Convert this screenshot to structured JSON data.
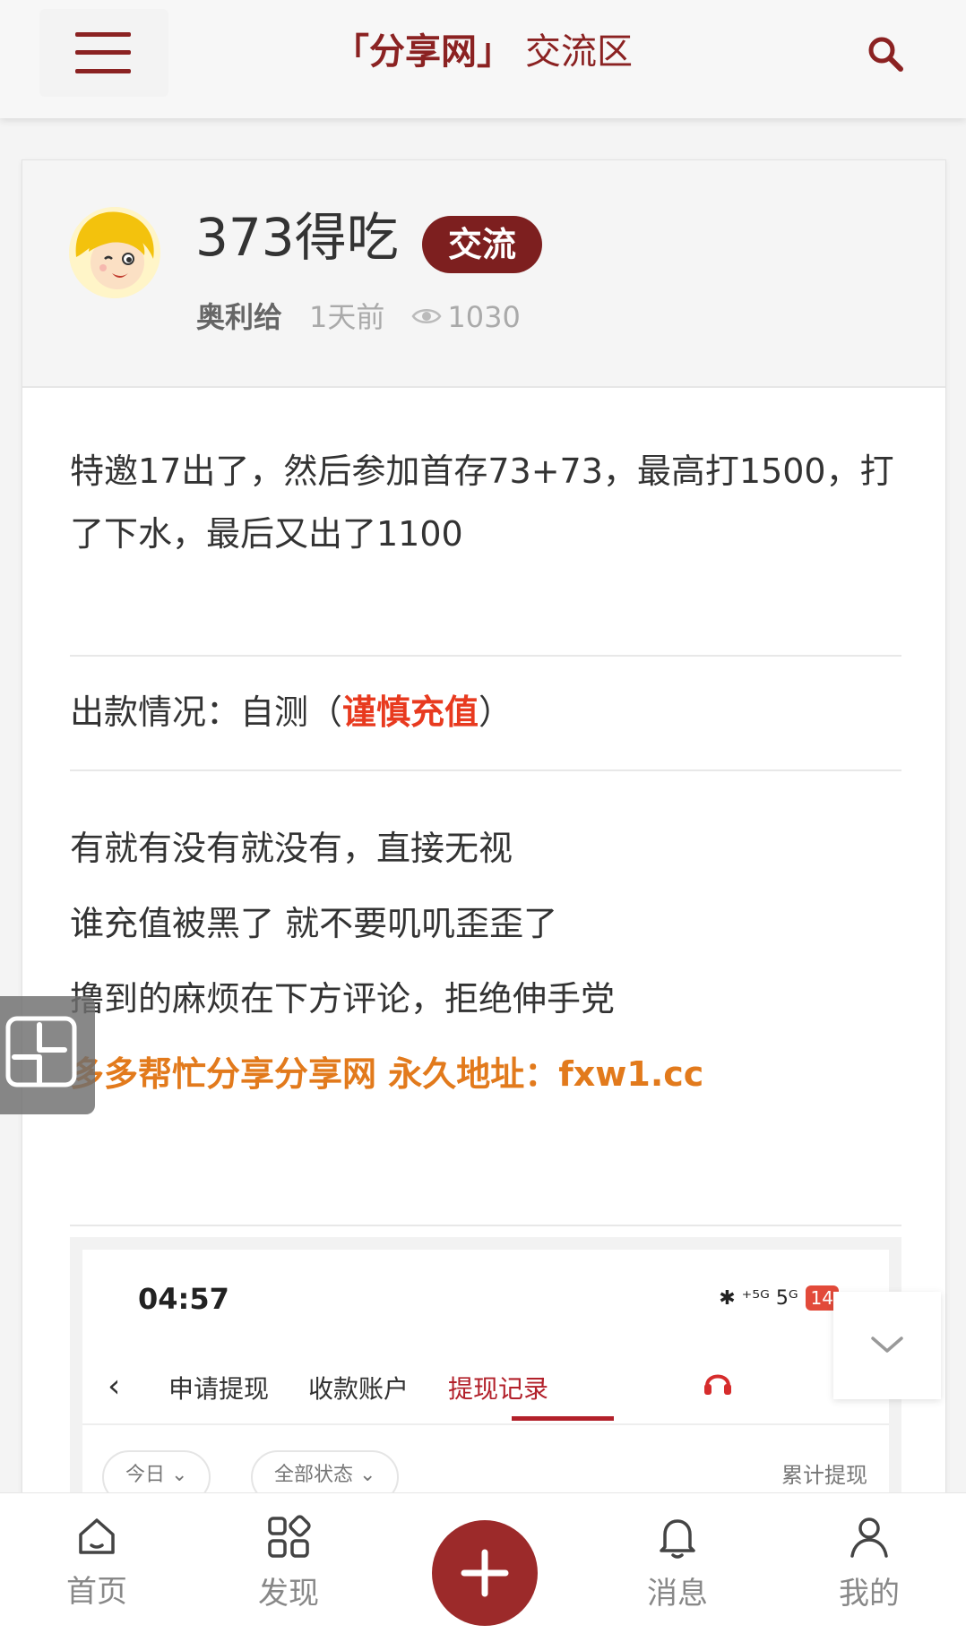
{
  "header": {
    "brand": "「分享网」",
    "section": "交流区"
  },
  "post": {
    "title": "373得吃",
    "tag": "交流",
    "author": "奥利给",
    "time": "1天前",
    "views": "1030"
  },
  "content": {
    "paragraph1": "特邀17出了，然后参加首存73+73，最高打1500，打了下水，最后又出了1100",
    "withdraw_prefix": "出款情况：自测（",
    "withdraw_warning": "谨慎充值",
    "withdraw_suffix": "）",
    "line1": "有就有没有就没有，直接无视",
    "line2": "谁充值被黑了 就不要叽叽歪歪了",
    "line3": "撸到的麻烦在下方评论，拒绝伸手党",
    "promo": "多多帮忙分享分享网 永久地址：fxw1.cc"
  },
  "embedded_screenshot": {
    "time": "04:57",
    "status": "✱ ⁺⁵ᴳ 5ᴳ",
    "battery": "14",
    "tabs": [
      "申请提现",
      "收款账户",
      "提现记录"
    ],
    "active_tab": "提现记录",
    "filters": [
      "今日",
      "全部状态"
    ],
    "total_label": "累计提现"
  },
  "bottom_nav": {
    "items": [
      {
        "label": "首页",
        "icon": "home-icon"
      },
      {
        "label": "发现",
        "icon": "grid-icon"
      },
      {
        "label": "消息",
        "icon": "bell-icon"
      },
      {
        "label": "我的",
        "icon": "user-icon"
      }
    ],
    "fab_icon": "plus-icon"
  },
  "colors": {
    "brand": "#8b2222",
    "tag_bg": "#7d1f1f",
    "warning": "#e83a1f",
    "promo": "#e27a1c",
    "fab": "#9c2a2a"
  }
}
